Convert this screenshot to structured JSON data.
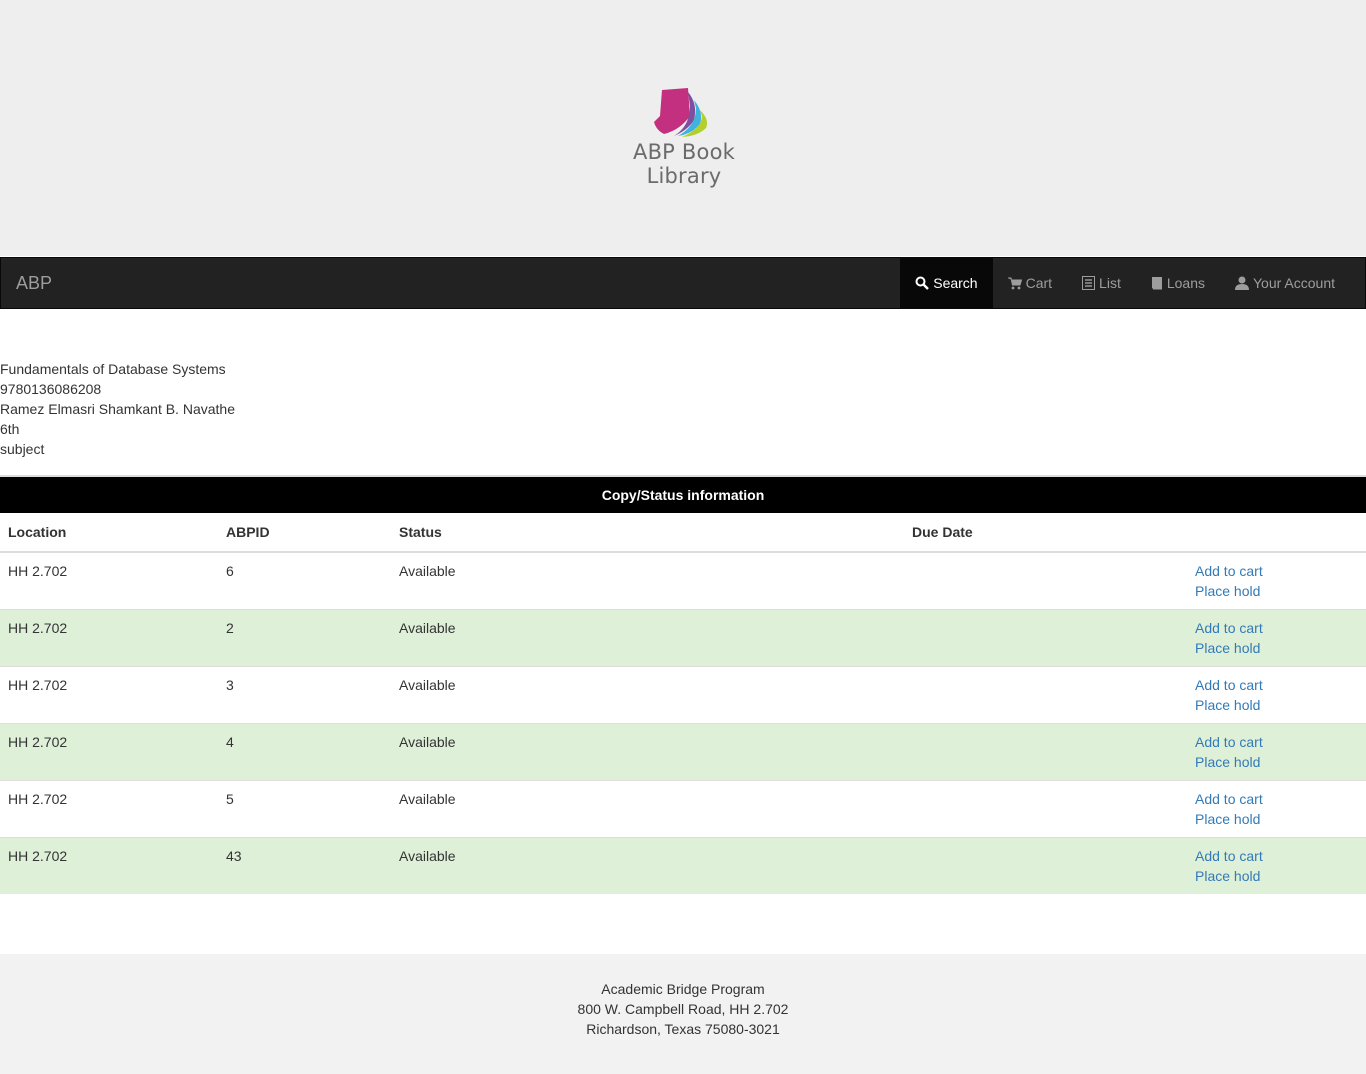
{
  "header": {
    "logo_text": "ABP Book Library",
    "logo_colors": [
      "#c2307f",
      "#3fb2df",
      "#b3cf2e",
      "#7d4fa0"
    ]
  },
  "navbar": {
    "brand": "ABP",
    "items": [
      {
        "label": "Search",
        "icon": "search-icon",
        "active": true
      },
      {
        "label": "Cart",
        "icon": "cart-icon",
        "active": false
      },
      {
        "label": "List",
        "icon": "list-icon",
        "active": false
      },
      {
        "label": "Loans",
        "icon": "book-icon",
        "active": false
      },
      {
        "label": "Your Account",
        "icon": "user-icon",
        "active": false
      }
    ]
  },
  "book": {
    "title": "Fundamentals of Database Systems",
    "isbn": "9780136086208",
    "authors": "Ramez Elmasri Shamkant B. Navathe",
    "edition": "6th",
    "subject": "subject"
  },
  "copies": {
    "caption": "Copy/Status information",
    "headers": [
      "Location",
      "ABPID",
      "Status",
      "Due Date",
      ""
    ],
    "action_add": "Add to cart",
    "action_hold": "Place hold",
    "rows": [
      {
        "location": "HH 2.702",
        "abpid": "6",
        "status": "Available",
        "due": "",
        "add": "Add to cart",
        "hold": "Place hold"
      },
      {
        "location": "HH 2.702",
        "abpid": "2",
        "status": "Available",
        "due": "",
        "add": "Add to cart",
        "hold": "Place hold"
      },
      {
        "location": "HH 2.702",
        "abpid": "3",
        "status": "Available",
        "due": "",
        "add": "Add to cart",
        "hold": "Place hold"
      },
      {
        "location": "HH 2.702",
        "abpid": "4",
        "status": "Available",
        "due": "",
        "add": "Add to cart",
        "hold": "Place hold"
      },
      {
        "location": "HH 2.702",
        "abpid": "5",
        "status": "Available",
        "due": "",
        "add": "Add to cart",
        "hold": "Place hold"
      },
      {
        "location": "HH 2.702",
        "abpid": "43",
        "status": "Available",
        "due": "",
        "add": "Add to cart",
        "hold": "Place hold"
      }
    ]
  },
  "footer": {
    "line1": "Academic Bridge Program",
    "line2": "800 W. Campbell Road, HH 2.702",
    "line3": "Richardson, Texas 75080-3021"
  }
}
